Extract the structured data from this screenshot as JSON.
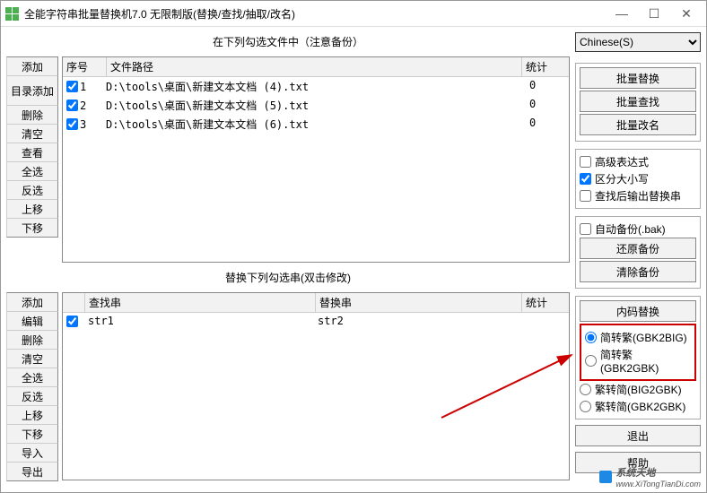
{
  "window": {
    "title": "全能字符串批量替换机7.0 无限制版(替换/查找/抽取/改名)"
  },
  "top_panel": {
    "caption": "在下列勾选文件中（注意备份）",
    "headers": {
      "seq": "序号",
      "path": "文件路径",
      "stat": "统计"
    },
    "buttons": [
      "添加",
      "目录添加",
      "删除",
      "清空",
      "查看",
      "全选",
      "反选",
      "上移",
      "下移"
    ],
    "rows": [
      {
        "checked": true,
        "seq": "1",
        "path": "D:\\tools\\桌面\\新建文本文档 (4).txt",
        "stat": "0"
      },
      {
        "checked": true,
        "seq": "2",
        "path": "D:\\tools\\桌面\\新建文本文档 (5).txt",
        "stat": "0"
      },
      {
        "checked": true,
        "seq": "3",
        "path": "D:\\tools\\桌面\\新建文本文档 (6).txt",
        "stat": "0"
      }
    ]
  },
  "bottom_panel": {
    "caption": "替换下列勾选串(双击修改)",
    "headers": {
      "find": "查找串",
      "repl": "替换串",
      "stat": "统计"
    },
    "buttons": [
      "添加",
      "编辑",
      "删除",
      "清空",
      "全选",
      "反选",
      "上移",
      "下移",
      "导入",
      "导出"
    ],
    "rows": [
      {
        "checked": true,
        "find": "str1",
        "repl": "str2",
        "stat": ""
      }
    ]
  },
  "right": {
    "encoding": "Chinese(S)",
    "batch": {
      "replace": "批量替换",
      "find": "批量查找",
      "rename": "批量改名"
    },
    "opts": {
      "adv": "高级表达式",
      "case": "区分大小写",
      "output": "查找后输出替换串"
    },
    "opts_checked": {
      "adv": false,
      "case": true,
      "output": false
    },
    "backup": {
      "auto": "自动备份(.bak)",
      "restore": "还原备份",
      "clear": "清除备份",
      "auto_checked": false
    },
    "encode_btn": "内码替换",
    "encode_opts": [
      {
        "label": "简转繁(GBK2BIG)",
        "checked": true,
        "group": "a"
      },
      {
        "label": "简转繁(GBK2GBK)",
        "checked": false,
        "group": "a"
      },
      {
        "label": "繁转简(BIG2GBK)",
        "checked": false,
        "group": "b"
      },
      {
        "label": "繁转简(GBK2GBK)",
        "checked": false,
        "group": "b"
      }
    ],
    "exit": "退出",
    "help": "帮助"
  },
  "watermark": {
    "brand": "系统天地",
    "url": "www.XiTongTianDi.com"
  }
}
